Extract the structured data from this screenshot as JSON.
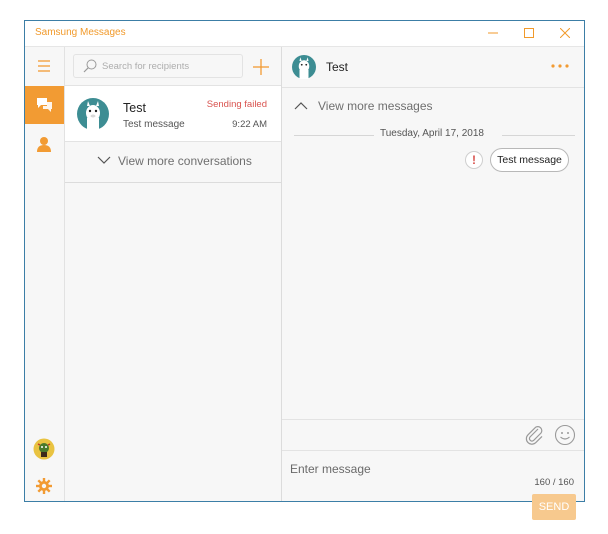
{
  "window": {
    "title": "Samsung Messages",
    "accent_color": "#f29b33",
    "error_color": "#d9534f",
    "controls": [
      "minimize-icon",
      "maximize-icon",
      "close-icon"
    ]
  },
  "nav": {
    "items": [
      {
        "name": "menu",
        "icon": "hamburger-icon"
      },
      {
        "name": "conversations",
        "icon": "chat-bubbles-icon",
        "selected": true
      },
      {
        "name": "contacts",
        "icon": "person-icon"
      },
      {
        "name": "profile",
        "icon": "avatar-icon"
      },
      {
        "name": "settings",
        "icon": "gear-icon"
      }
    ]
  },
  "conversations": {
    "search_placeholder": "Search for recipients",
    "new_icon": "plus-icon",
    "items": [
      {
        "name": "Test",
        "preview": "Test message",
        "status": "Sending failed",
        "time": "9:22 AM",
        "avatar": "llama-avatar"
      }
    ],
    "view_more_label": "View more conversations"
  },
  "chat": {
    "contact_name": "Test",
    "view_more_label": "View more messages",
    "date_separator": "Tuesday, April 17, 2018",
    "messages": [
      {
        "text": "Test message",
        "status": "failed",
        "status_icon": "exclamation-icon"
      }
    ],
    "compose_placeholder": "Enter message",
    "char_count": "160 / 160",
    "send_label": "SEND",
    "attach_icon": "paperclip-icon",
    "emoji_icon": "smiley-icon",
    "more_icon": "more-dots-icon"
  }
}
